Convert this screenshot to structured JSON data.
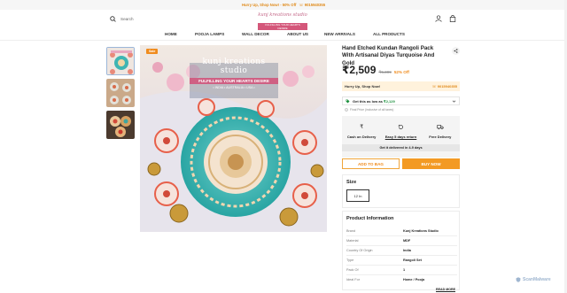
{
  "announcement": {
    "text": "Hurry Up, Shop Now! - 50% Off",
    "phone": "☏ 9015940355"
  },
  "header": {
    "search_label": "Search",
    "logo_title": "kunj kreations studio",
    "logo_tagline": "FULFILLING YOUR HEARTS DESIRE"
  },
  "nav": [
    {
      "label": "HOME"
    },
    {
      "label": "POOJA LAMPS"
    },
    {
      "label": "WALL DECOR"
    },
    {
      "label": "ABOUT US"
    },
    {
      "label": "NEW ARRIVALS"
    },
    {
      "label": "ALL PRODUCTS"
    }
  ],
  "gallery": {
    "badge": "Sale",
    "main_overlay_title": "kunj kreations studio",
    "main_overlay_subtitle": "FULFILLING YOUR HEARTS DESIRE",
    "main_overlay_countries": "• INDIA • AUSTRALIA • USA •"
  },
  "product": {
    "title": "Hand Etched Kundan Rangoli Pack With Artisanal Diyas Turquoise And Gold",
    "price": "₹2,509",
    "mrp": "₹5,399",
    "discount": "52% Off",
    "hurry_left": "Hurry Up, Shop Now!",
    "hurry_right": "☏ 9015940355",
    "coupon_prefix": "Get this as low as",
    "coupon_price": "₹2,129",
    "final_price_note": "Final Price (inclusive of all taxes)",
    "features": [
      {
        "icon": "rupee-icon",
        "label": "Cash on Delivery"
      },
      {
        "icon": "return-icon",
        "label": "Easy 5 days return"
      },
      {
        "icon": "truck-icon",
        "label": "Free Delivery"
      }
    ],
    "delivery_text": "Get it delivered in 4-9 days",
    "add_to_bag": "ADD TO BAG",
    "buy_now": "BUY NOW",
    "size_heading": "Size",
    "size_selected": "12 In"
  },
  "product_information": {
    "heading": "Product Information",
    "rows": [
      {
        "key": "Brand",
        "value": "Kunj Kreations Studio"
      },
      {
        "key": "Material",
        "value": "MDF"
      },
      {
        "key": "Country Of Origin",
        "value": "India"
      },
      {
        "key": "Type",
        "value": "Rangoli Set"
      },
      {
        "key": "Pack Of",
        "value": "1"
      },
      {
        "key": "Ideal For",
        "value": "Home / Pooja"
      }
    ],
    "read_more": "READ MORE"
  },
  "watermark": "ScanMalware",
  "colors": {
    "accent": "#f39a24",
    "announce_text": "#e08a1a",
    "coupon_green": "#1a8f3c",
    "hurry_bg": "#fff2dc"
  }
}
